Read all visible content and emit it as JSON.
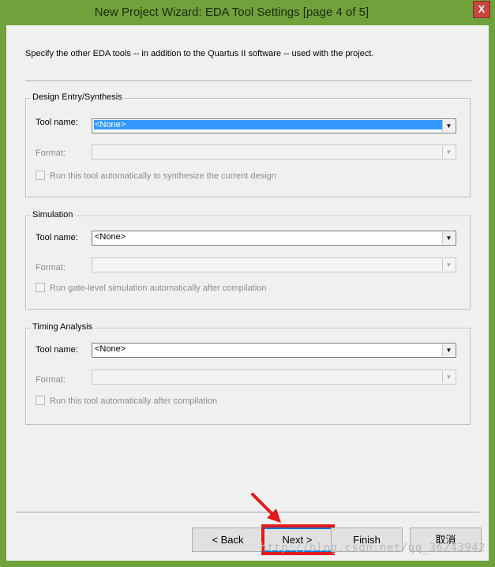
{
  "window": {
    "title": "New Project Wizard: EDA Tool Settings [page 4 of 5]",
    "close_label": "X"
  },
  "description": "Specify the other EDA tools -- in addition to the Quartus II software -- used with the project.",
  "sections": [
    {
      "title": "Design Entry/Synthesis",
      "tool_label": "Tool name:",
      "tool_value": "<None>",
      "format_label": "Format:",
      "checkbox_label": "Run this tool automatically to synthesize the current design"
    },
    {
      "title": "Simulation",
      "tool_label": "Tool name:",
      "tool_value": "<None>",
      "format_label": "Format:",
      "checkbox_label": "Run gate-level simulation automatically after compilation"
    },
    {
      "title": "Timing Analysis",
      "tool_label": "Tool name:",
      "tool_value": "<None>",
      "format_label": "Format:",
      "checkbox_label": "Run this tool automatically after compilation"
    }
  ],
  "buttons": {
    "back": "< Back",
    "next": "Next >",
    "finish": "Finish",
    "cancel": "取消"
  },
  "watermark": "http://blog.csdn.net/qq_36243942",
  "colors": {
    "title_bar": "#6fa23a",
    "selection": "#3399ff",
    "highlight": "#e3191b"
  }
}
